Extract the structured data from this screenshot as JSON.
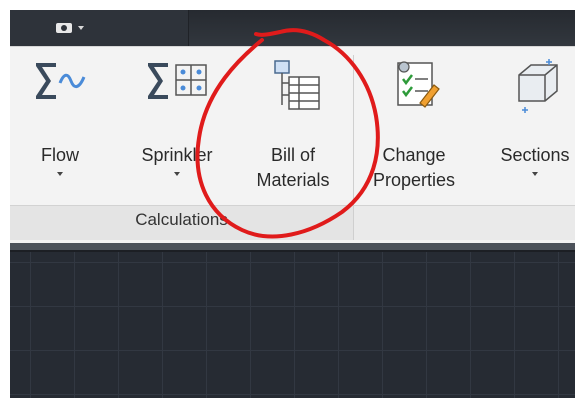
{
  "ribbon": {
    "buttons": [
      {
        "label": "Flow",
        "has_dropdown": true,
        "icon": "sigma-flow-icon"
      },
      {
        "label": "Sprinkler",
        "has_dropdown": true,
        "icon": "sigma-sprinkler-icon"
      },
      {
        "label": "Bill of\nMaterials",
        "has_dropdown": false,
        "icon": "bill-of-materials-icon"
      },
      {
        "label": "Change\nProperties",
        "has_dropdown": false,
        "icon": "change-properties-icon"
      },
      {
        "label": "Sections",
        "has_dropdown": true,
        "icon": "sections-icon"
      }
    ],
    "panel_title": "Calculations"
  },
  "quick_access": {
    "icon": "camera-icon"
  },
  "annotation": {
    "color": "#e01b1b"
  }
}
